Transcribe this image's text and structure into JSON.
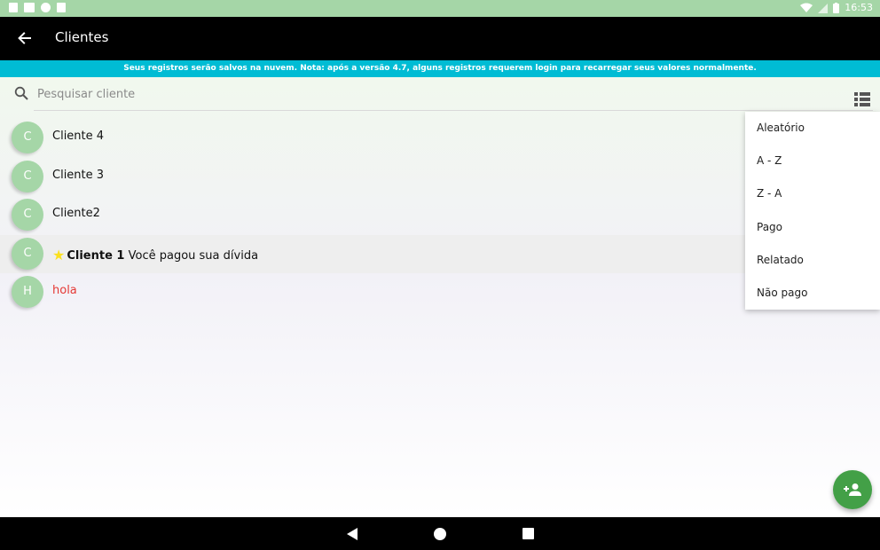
{
  "status_bar": {
    "time": "16:53",
    "left_icons": [
      "android-icon",
      "mail-icon",
      "circle-icon",
      "sd-card-icon"
    ],
    "right_icons": [
      "wifi-icon",
      "signal-icon",
      "battery-icon"
    ]
  },
  "app_bar": {
    "title": "Clientes",
    "back_icon": "arrow-back-icon"
  },
  "notice": {
    "text": "Seus registros serão salvos na nuvem. Nota: após a versão 4.7, alguns registros requerem login para recarregar seus valores normalmente."
  },
  "search": {
    "placeholder": "Pesquisar cliente",
    "value": ""
  },
  "clients": [
    {
      "initial": "C",
      "name": "Cliente 4"
    },
    {
      "initial": "C",
      "name": "Cliente 3"
    },
    {
      "initial": "C",
      "name": "Cliente2"
    },
    {
      "initial": "C",
      "name": "Cliente 1",
      "message": "Você pagou sua dívida",
      "starred": true
    },
    {
      "initial": "H",
      "name": "hola"
    }
  ],
  "sort_menu": {
    "items": [
      "Aleatório",
      "A - Z",
      "Z - A",
      "Pago",
      "Relatado",
      "Não pago"
    ]
  },
  "colors": {
    "status_bar": "#a5d6a7",
    "app_bar": "#000000",
    "notice": "#00bcd4",
    "avatar": "#a5d6a7",
    "fab": "#43a047",
    "alert_text": "#e53935",
    "star": "#fbe01f"
  },
  "fab": {
    "icon": "add-person-icon"
  },
  "nav": {
    "icons": [
      "nav-back-icon",
      "nav-home-icon",
      "nav-recents-icon"
    ]
  }
}
